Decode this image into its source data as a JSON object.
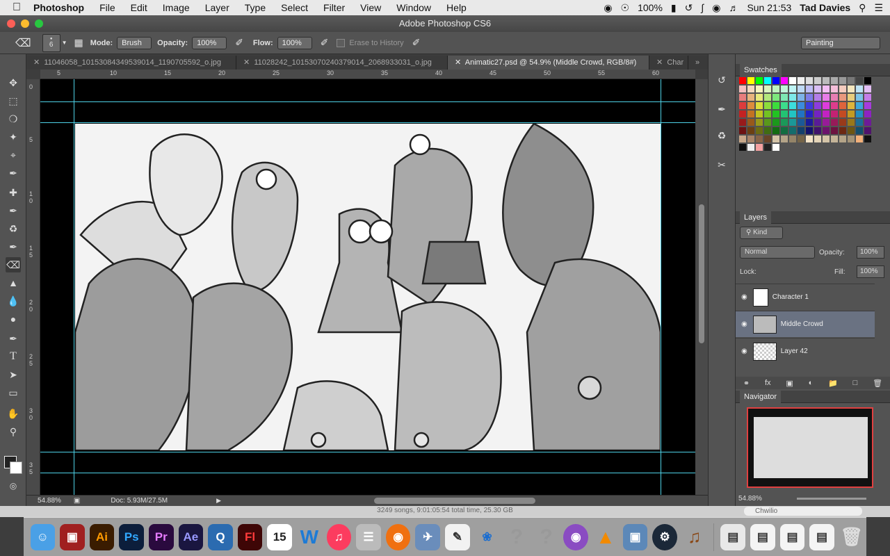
{
  "menubar": {
    "app": "Photoshop",
    "items": [
      "File",
      "Edit",
      "Image",
      "Layer",
      "Type",
      "Select",
      "Filter",
      "View",
      "Window",
      "Help"
    ],
    "battery": "100%",
    "clock": "Sun 21:53",
    "user": "Tad Davies"
  },
  "window": {
    "title": "Adobe Photoshop CS6"
  },
  "options": {
    "brush_size": "6",
    "mode_label": "Mode:",
    "mode_value": "Brush",
    "opacity_label": "Opacity:",
    "opacity_value": "100%",
    "flow_label": "Flow:",
    "flow_value": "100%",
    "erase_history": "Erase to History",
    "workspace": "Painting"
  },
  "tabs": [
    {
      "label": "11046058_10153084349539014_1190705592_o.jpg"
    },
    {
      "label": "11028242_10153070240379014_2068933031_o.jpg"
    },
    {
      "label": "Animatic27.psd @ 54.9% (Middle Crowd, RGB/8#)"
    },
    {
      "label": "Char"
    }
  ],
  "ruler_h": [
    "5",
    "10",
    "15",
    "20",
    "25",
    "30",
    "35",
    "40",
    "45",
    "50",
    "55",
    "60"
  ],
  "ruler_v": [
    "0",
    "5",
    "1 0",
    "1 5",
    "2 0",
    "2 5",
    "3 0",
    "3 5"
  ],
  "status": {
    "zoom": "54.88%",
    "doc": "Doc: 5.93M/27.5M"
  },
  "panels": {
    "swatches_title": "Swatches",
    "layers_title": "Layers",
    "kind": "Kind",
    "blend_mode": "Normal",
    "opacity_label": "Opacity:",
    "opacity_value": "100%",
    "lock_label": "Lock:",
    "fill_label": "Fill:",
    "fill_value": "100%",
    "layers": [
      {
        "name": "Character 1"
      },
      {
        "name": "Middle Crowd"
      },
      {
        "name": "Layer 42"
      }
    ],
    "navigator_title": "Navigator",
    "nav_zoom": "54.88%"
  },
  "itunes_status": "3249 songs, 9:01:05:54 total time, 25.30 GB",
  "search_placeholder": "Chwilio",
  "dock": [
    {
      "label": "Ai",
      "color": "#3a1c00"
    },
    {
      "label": "Ps",
      "color": "#0c1e3b"
    },
    {
      "label": "Pr",
      "color": "#2a0a3e"
    },
    {
      "label": "Ae",
      "color": "#1a1640"
    },
    {
      "label": "Fl",
      "color": "#3e0606"
    },
    {
      "label": "15",
      "color": "#ffffff"
    },
    {
      "label": "W",
      "color": "#1d7bd6"
    },
    {
      "label": "?",
      "color": "#999999"
    }
  ],
  "swatch_colors": [
    "#ff0000",
    "#ffff00",
    "#00ff00",
    "#00ffff",
    "#0000ff",
    "#ff00ff",
    "#ffffff",
    "#eeeeee",
    "#dddddd",
    "#cccccc",
    "#bbbbbb",
    "#aaaaaa",
    "#999999",
    "#777777",
    "#444444",
    "#000000"
  ]
}
